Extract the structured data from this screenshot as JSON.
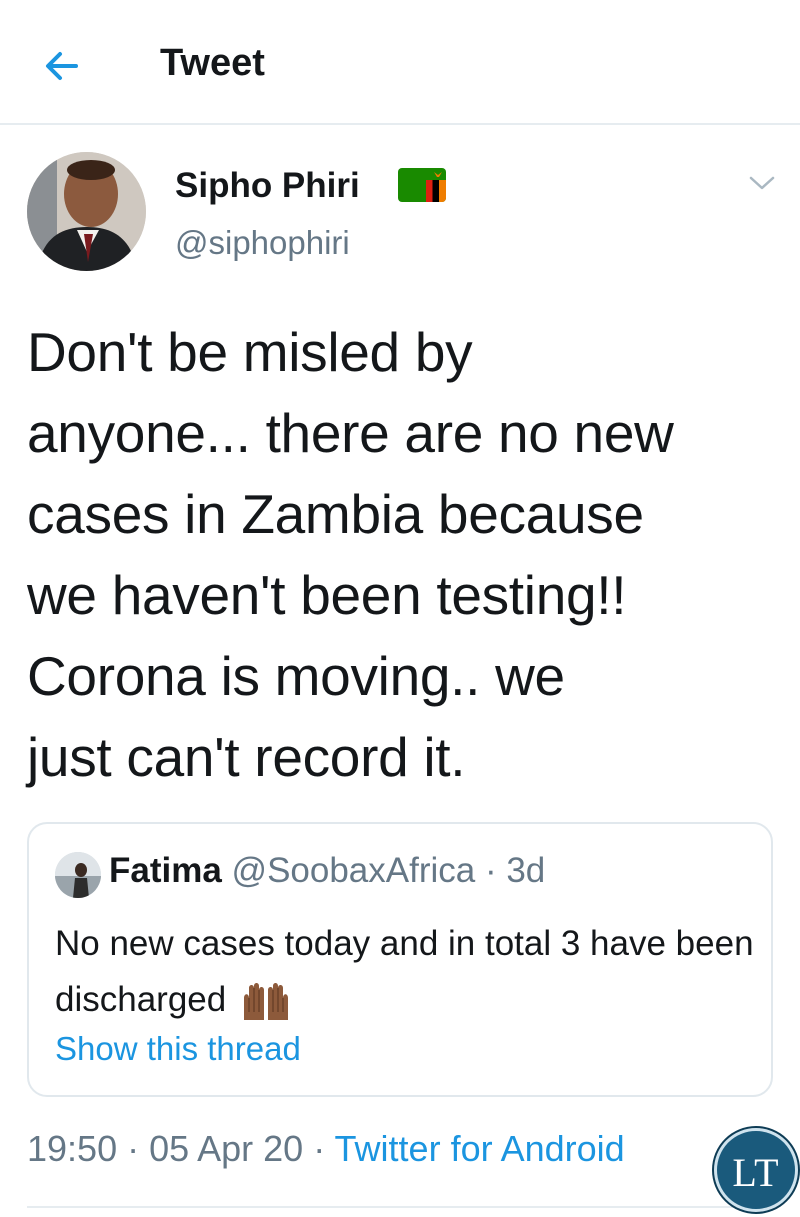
{
  "header": {
    "back_icon": "back-arrow-icon",
    "title": "Tweet"
  },
  "tweet": {
    "author_name": "Sipho Phiri",
    "author_flag": "zambia-flag-emoji",
    "handle": "@siphophiri",
    "menu_icon": "chevron-down-icon",
    "text": "Don't be misled by\nanyone... there are no new\ncases in Zambia because\nwe haven't been testing!!\nCorona is moving..  we\njust can't record it.",
    "timestamp": "19:50 · 05 Apr 20 · ",
    "source": "Twitter for Android"
  },
  "quote": {
    "name": "Fatima",
    "handle_time": " @SoobaxAfrica · 3d",
    "text": "No new cases today and in total 3 have been discharged",
    "emoji": "raised-hands-emoji",
    "show_thread": "Show this thread"
  },
  "watermark": {
    "text": "LT"
  },
  "colors": {
    "accent": "#1b95e0",
    "secondary_text": "#657786",
    "primary_text": "#14171a",
    "border": "#e1e8ed",
    "watermark_bg": "#1a5a7c"
  }
}
